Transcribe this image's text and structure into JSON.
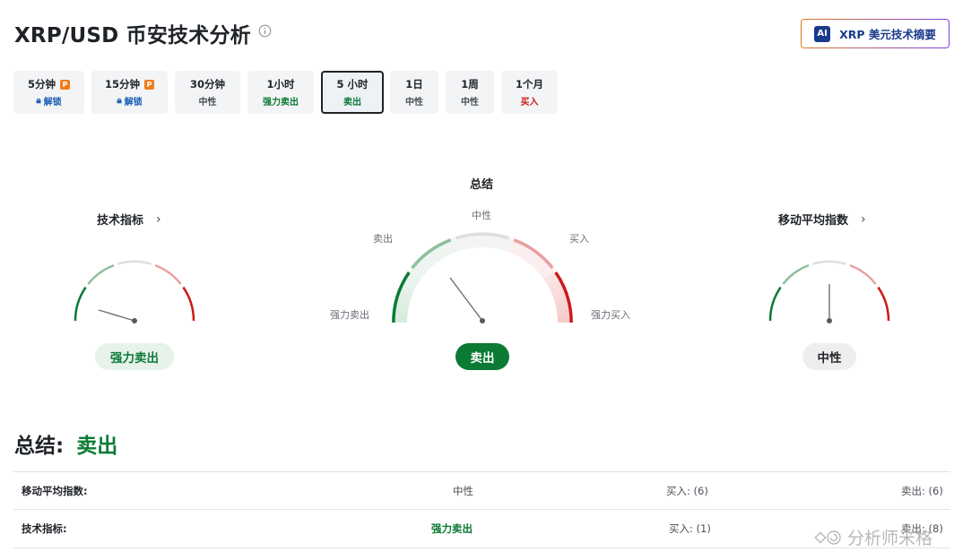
{
  "header": {
    "title": "XRP/USD 币安技术分析",
    "ai_button_label": "XRP 美元技术摘要",
    "ai_badge": "AI"
  },
  "tabs": [
    {
      "label": "5分钟",
      "status": "解锁",
      "locked": true
    },
    {
      "label": "15分钟",
      "status": "解锁",
      "locked": true
    },
    {
      "label": "30分钟",
      "status": "中性"
    },
    {
      "label": "1小时",
      "status": "强力卖出"
    },
    {
      "label": "5 小时",
      "status": "卖出",
      "active": true
    },
    {
      "label": "1日",
      "status": "中性"
    },
    {
      "label": "1周",
      "status": "中性"
    },
    {
      "label": "1个月",
      "status": "买入"
    }
  ],
  "gauges": {
    "technical": {
      "title": "技术指标",
      "reading": "强力卖出"
    },
    "summary": {
      "title": "总结",
      "reading": "卖出",
      "labels": {
        "neutral": "中性",
        "sell": "卖出",
        "buy": "买入",
        "strong_sell": "强力卖出",
        "strong_buy": "强力买入"
      }
    },
    "moving_averages": {
      "title": "移动平均指数",
      "reading": "中性"
    }
  },
  "summary_line": {
    "label": "总结:",
    "value": "卖出"
  },
  "table": [
    {
      "name": "移动平均指数:",
      "status": "中性",
      "buy": "买入: (6)",
      "sell": "卖出: (6)"
    },
    {
      "name": "技术指标:",
      "status": "强力卖出",
      "buy": "买入: (1)",
      "sell": "卖出: (8)"
    }
  ],
  "watermark": "分析师米格",
  "colors": {
    "strong_sell": "#0b7a34",
    "sell": "#8dbf9b",
    "neutral": "#dedede",
    "buy": "#e8a0a0",
    "strong_buy": "#cc1a1a",
    "buy_text": "#cc1a1a",
    "sell_text": "#0b7a34",
    "neutral_text": "#1f2328"
  }
}
